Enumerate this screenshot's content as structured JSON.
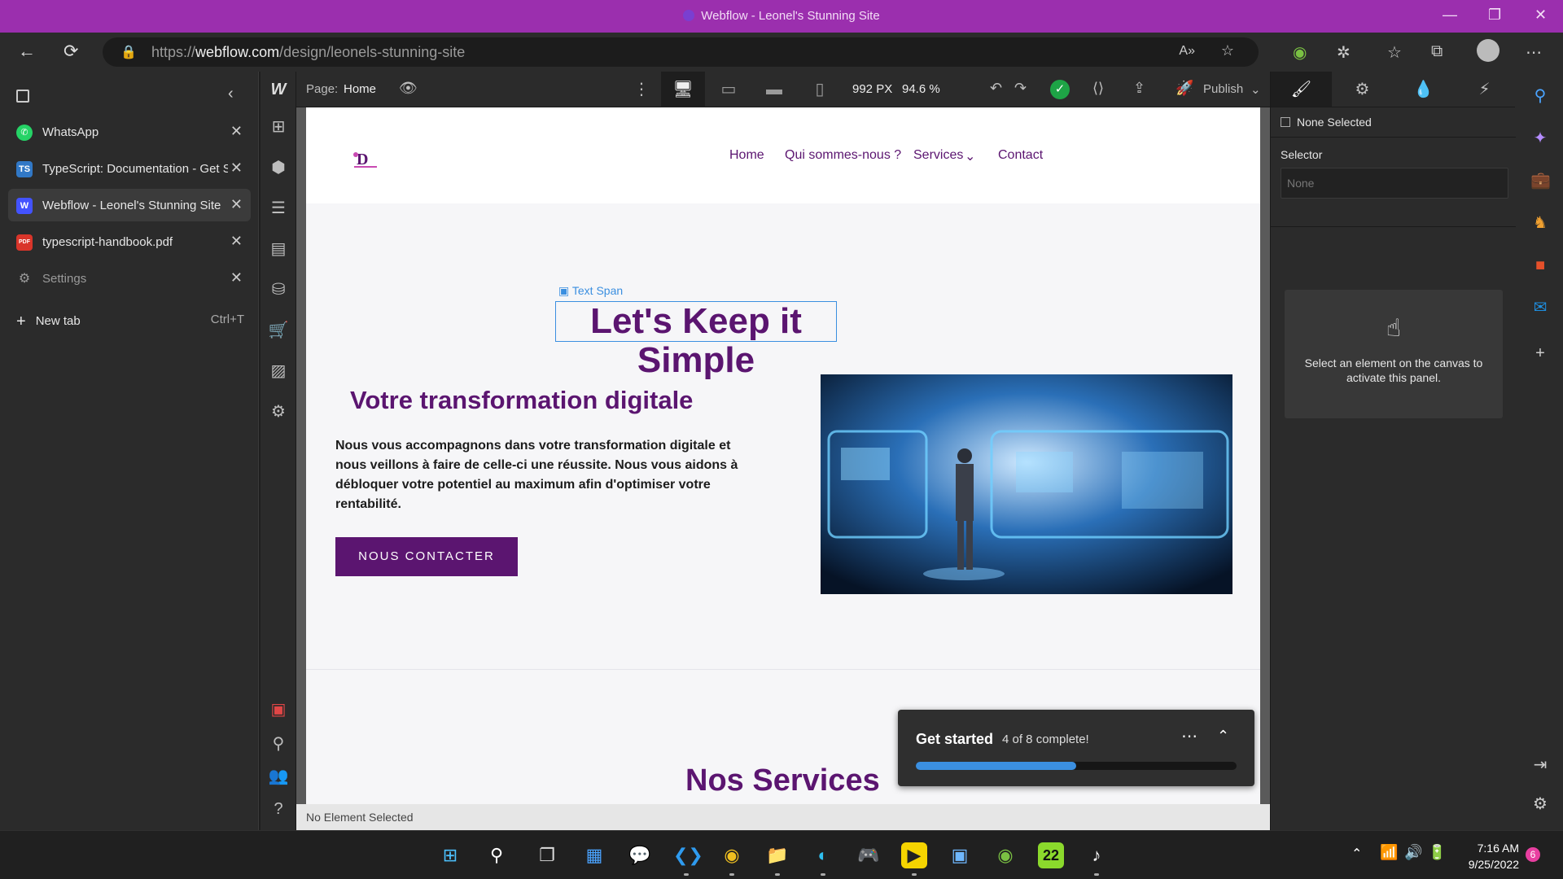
{
  "window": {
    "title": "Webflow - Leonel's Stunning Site",
    "controls": [
      "—",
      "❐",
      "✕"
    ]
  },
  "browser": {
    "url_prefix": "https://",
    "url_domain": "webflow.com",
    "url_path": "/design/leonels-stunning-site",
    "read_aloud_icon": "A»",
    "tabs": [
      {
        "label": "WhatsApp",
        "icon": "whatsapp-icon",
        "color": "#25d366"
      },
      {
        "label": "TypeScript: Documentation - Get Started",
        "icon": "typescript-icon",
        "glyph": "TS",
        "color": "#3178c6"
      },
      {
        "label": "Webflow - Leonel's Stunning Site",
        "icon": "webflow-icon",
        "glyph": "W",
        "color": "#4353ff",
        "active": true
      },
      {
        "label": "typescript-handbook.pdf",
        "icon": "pdf-icon",
        "glyph": "PDF",
        "color": "#d9352a"
      },
      {
        "label": "Settings",
        "icon": "settings-icon",
        "dim": true
      }
    ],
    "new_tab": {
      "label": "New tab",
      "shortcut": "Ctrl+T"
    }
  },
  "webflow": {
    "logo": "W",
    "page_label": "Page:",
    "page_name": "Home",
    "canvas_width": "992 PX",
    "zoom": "94.6 %",
    "publish": "Publish",
    "panel": {
      "none_selected": "None Selected",
      "selector_label": "Selector",
      "selector_placeholder": "None",
      "hint": "Select an element on the canvas to activate this panel."
    },
    "status": "No Element Selected",
    "get_started": {
      "title": "Get started",
      "progress_text": "4 of 8 complete!",
      "progress": 0.5
    }
  },
  "site": {
    "nav": [
      "Home",
      "Qui sommes-nous ?",
      "Services",
      "Contact"
    ],
    "selected_badge": "Text Span",
    "headline": "Let's Keep it Simple",
    "heading": "Votre transformation digitale",
    "paragraph": "Nous vous accompagnons dans votre transformation digitale et nous veillons à faire de celle-ci une réussite. Nous vous aidons à débloquer votre potentiel au maximum afin d'optimiser votre rentabilité.",
    "cta": "NOUS CONTACTER",
    "services_title": "Nos Services"
  },
  "taskbar": {
    "time": "7:16 AM",
    "date": "9/25/2022",
    "notifications": "6",
    "apps": [
      "windows-start-icon",
      "search-icon",
      "task-view-icon",
      "widgets-icon",
      "teams-chat-icon",
      "vscode-icon",
      "chrome-icon",
      "file-explorer-icon",
      "edge-icon",
      "game-controller-icon",
      "player-icon",
      "control-panel-icon",
      "edge-canary-icon",
      "badge-22-icon",
      "tiktok-icon"
    ],
    "app22_label": "22"
  }
}
